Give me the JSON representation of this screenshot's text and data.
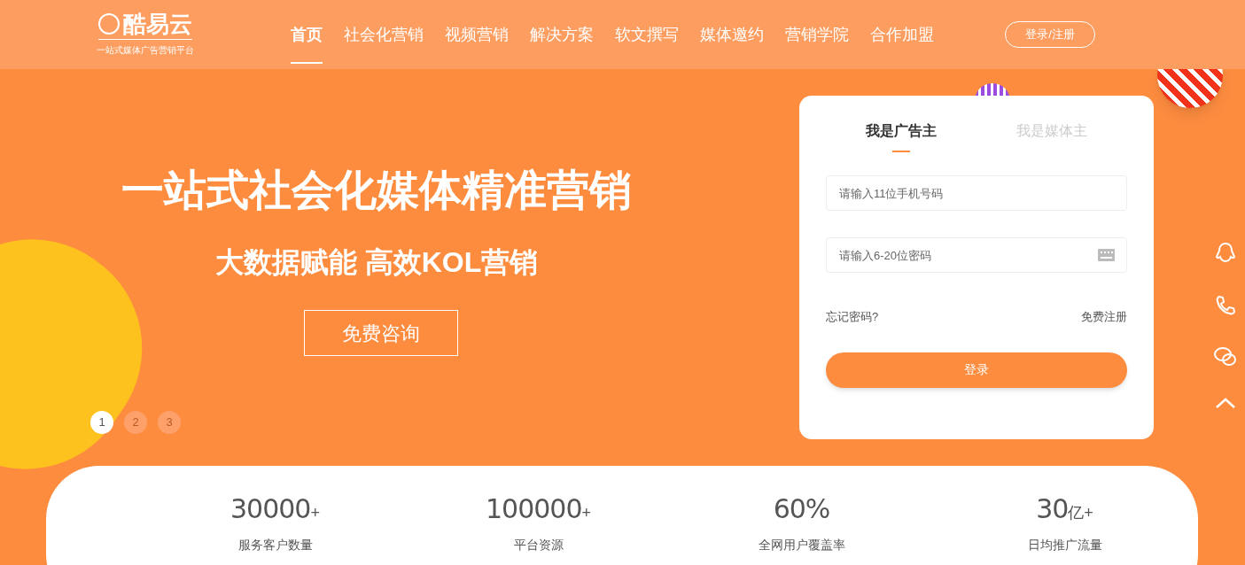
{
  "logo": {
    "name": "酷易云",
    "tagline": "一站式媒体广告营销平台"
  },
  "nav": [
    {
      "label": "首页",
      "selected": true
    },
    {
      "label": "社会化营销",
      "selected": false
    },
    {
      "label": "视频营销",
      "selected": false
    },
    {
      "label": "解决方案",
      "selected": false
    },
    {
      "label": "软文撰写",
      "selected": false
    },
    {
      "label": "媒体邀约",
      "selected": false
    },
    {
      "label": "营销学院",
      "selected": false
    },
    {
      "label": "合作加盟",
      "selected": false
    }
  ],
  "header_button": "登录/注册",
  "hero": {
    "title": "一站式社会化媒体精准营销",
    "subtitle": "大数据赋能 高效KOL营销",
    "button": "免费咨询"
  },
  "carousel_dots": [
    {
      "label": "1",
      "selected": true
    },
    {
      "label": "2",
      "selected": false
    },
    {
      "label": "3",
      "selected": false
    }
  ],
  "login": {
    "tabs": [
      {
        "label": "我是广告主",
        "selected": true
      },
      {
        "label": "我是媒体主",
        "selected": false
      }
    ],
    "phone": {
      "placeholder": "请输入11位手机号码"
    },
    "password": {
      "placeholder": "请输入6-20位密码"
    },
    "forgot": "忘记密码?",
    "register": "免费注册",
    "submit": "登录"
  },
  "stats": [
    {
      "value": "30000",
      "suffix": "+",
      "label": "服务客户数量"
    },
    {
      "value": "100000",
      "suffix": "+",
      "label": "平台资源"
    },
    {
      "value": "60%",
      "label": "全网用户覆盖率"
    },
    {
      "value": "30",
      "suffix": "亿+",
      "label": "日均推广流量"
    }
  ]
}
